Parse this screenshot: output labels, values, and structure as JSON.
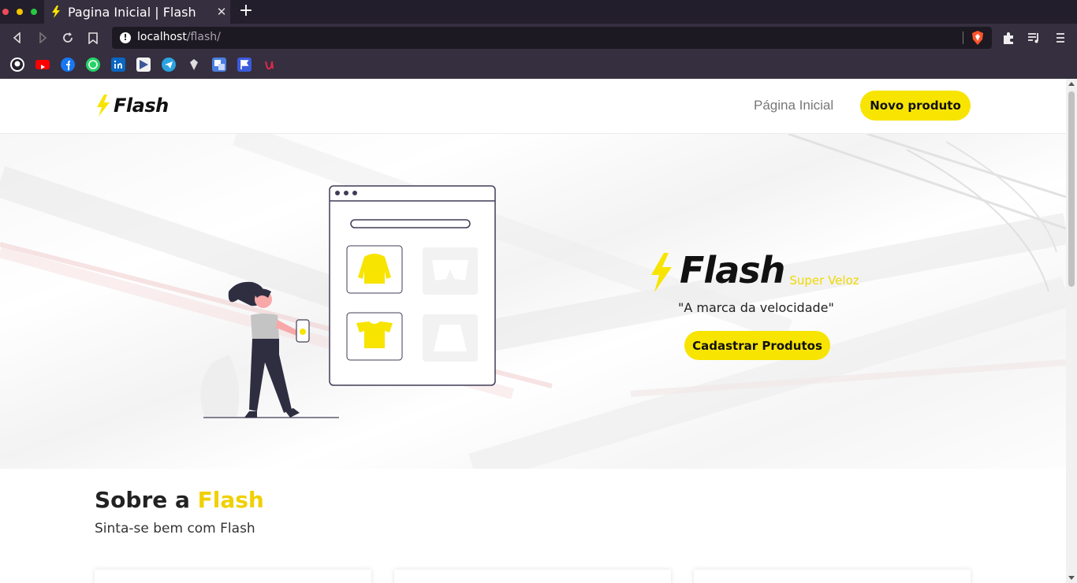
{
  "browser": {
    "tab_title": "Pagina Inicial | Flash",
    "tab_close": "✕",
    "new_tab": "+",
    "url_host": "localhost",
    "url_path": "/flash/",
    "bookmarks": [
      "github-icon",
      "youtube-icon",
      "facebook-icon",
      "whatsapp-icon",
      "linkedin-icon",
      "play-icon",
      "telegram-icon",
      "diamond-icon",
      "translate-icon",
      "flag-icon",
      "u-icon"
    ]
  },
  "navbar": {
    "logo_text": "Flash",
    "home_link": "Página Inicial",
    "new_product_button": "Novo produto"
  },
  "hero": {
    "brand": "Flash",
    "brand_sub": "Super Veloz",
    "slogan": "\"A marca da velocidade\"",
    "cta_button": "Cadastrar Produtos"
  },
  "about": {
    "title_prefix": "Sobre a ",
    "title_accent": "Flash",
    "subtitle": "Sinta-se bem com Flash"
  },
  "colors": {
    "accent": "#f8e401",
    "dark": "#231e2b"
  }
}
